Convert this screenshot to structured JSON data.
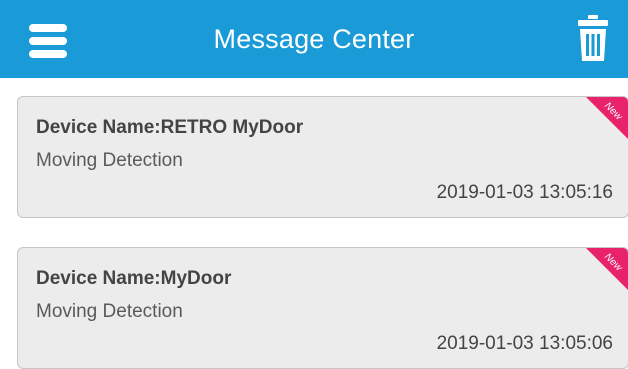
{
  "header": {
    "title": "Message Center",
    "menu_icon": "hamburger-menu-icon",
    "delete_icon": "trash-icon",
    "background_color": "#1a9ad6"
  },
  "messages": [
    {
      "device_name": "Device Name:RETRO MyDoor",
      "event": "Moving Detection",
      "timestamp": "2019-01-03 13:05:16",
      "badge": "New",
      "badge_color": "#e8236c"
    },
    {
      "device_name": "Device Name:MyDoor",
      "event": "Moving Detection",
      "timestamp": "2019-01-03 13:05:06",
      "badge": "New",
      "badge_color": "#e8236c"
    }
  ]
}
